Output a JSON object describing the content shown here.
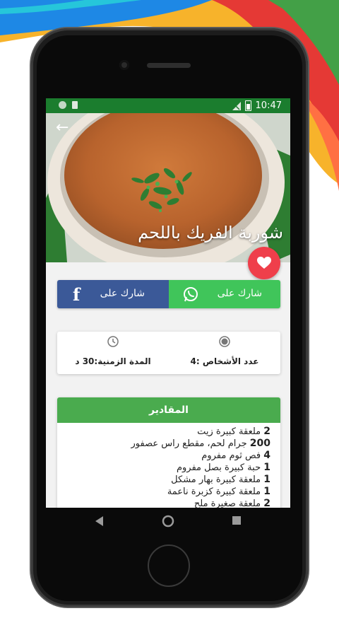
{
  "status_bar": {
    "time": "10:47"
  },
  "recipe": {
    "title": "شوربة الفريك باللحم"
  },
  "share": {
    "whatsapp_label": "شارك على",
    "facebook_label": "شارك على",
    "facebook_glyph": "f"
  },
  "info": {
    "persons": "عدد الأشخاص :4",
    "duration": "المدة الزمنية:30 د"
  },
  "ingredients": {
    "header": "المقادير",
    "items": [
      {
        "qty": "2",
        "text": "ملعقة كبيرة زيت"
      },
      {
        "qty": "200",
        "text": "جرام لحم، مقطع راس عصفور"
      },
      {
        "qty": "4",
        "text": "فص ثوم مفروم"
      },
      {
        "qty": "1",
        "text": "حبة كبيرة بصل مفروم"
      },
      {
        "qty": "1",
        "text": "ملعقة كبيرة بهار مشكل"
      },
      {
        "qty": "1",
        "text": "ملعقة كبيرة كزبرة ناعمة"
      },
      {
        "qty": "2",
        "text": "ملعقة صغيرة ملح"
      }
    ]
  },
  "icons": {
    "back": "back-arrow-icon",
    "favorite": "heart-icon",
    "whatsapp": "whatsapp-icon",
    "facebook": "facebook-icon",
    "persons": "radio-dot-icon",
    "duration": "clock-icon"
  },
  "colors": {
    "status_bar": "#1b7d2e",
    "whatsapp": "#40c55a",
    "facebook": "#3b5998",
    "favorite": "#ef3f4b",
    "ingredients_header": "#4aab4e"
  }
}
